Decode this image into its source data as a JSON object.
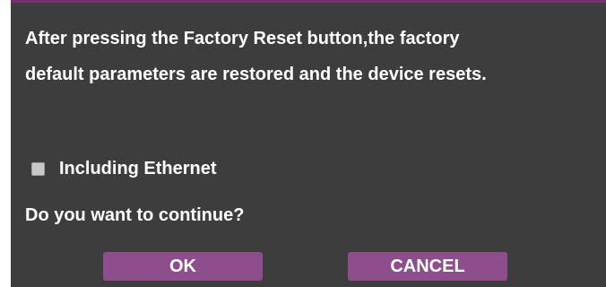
{
  "dialog": {
    "message_line1": "After pressing the Factory Reset button,the factory",
    "message_line2": "default parameters are restored and the device resets.",
    "option_label": "Including Ethernet",
    "option_checked": false,
    "question": "Do you want to continue?",
    "ok_label": "OK",
    "cancel_label": "CANCEL"
  },
  "colors": {
    "background": "#3d3d3d",
    "accent": "#8e4d8c",
    "text": "#ffffff"
  }
}
